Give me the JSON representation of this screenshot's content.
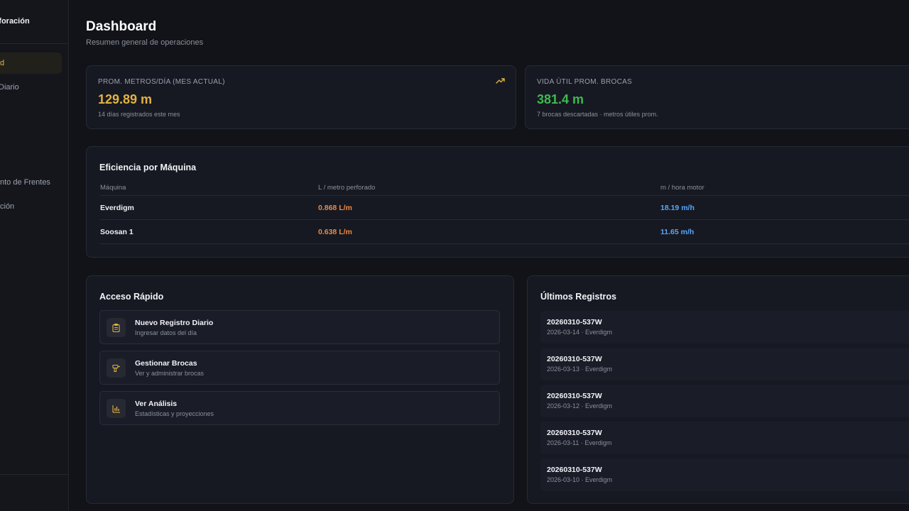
{
  "sidebar": {
    "brand": "rforación",
    "items": [
      {
        "label": "d",
        "active": true
      },
      {
        "label": "Diario"
      },
      {
        "label": ""
      },
      {
        "label": "nto de Frentes"
      },
      {
        "label": "ción"
      }
    ]
  },
  "header": {
    "title": "Dashboard",
    "subtitle": "Resumen general de operaciones"
  },
  "stats": [
    {
      "label": "PROM. METROS/DÍA (MES ACTUAL)",
      "value": "129.89 m",
      "note": "14 días registrados este mes",
      "color": "#e3b341",
      "icon": "trend-up-icon"
    },
    {
      "label": "VIDA ÚTIL PROM. BROCAS",
      "value": "381.4 m",
      "note": "7 brocas descartadas · metros útiles prom.",
      "color": "#3fb950"
    }
  ],
  "efficiency": {
    "title": "Eficiencia por Máquina",
    "columns": [
      "Máquina",
      "L / metro perforado",
      "m / hora motor"
    ],
    "rows": [
      {
        "machine": "Everdigm",
        "l_per_meter": "0.868 L/m",
        "m_per_hour": "18.19 m/h"
      },
      {
        "machine": "Soosan 1",
        "l_per_meter": "0.638 L/m",
        "m_per_hour": "11.65 m/h"
      }
    ]
  },
  "quick_access": {
    "title": "Acceso Rápido",
    "items": [
      {
        "title": "Nuevo Registro Diario",
        "subtitle": "Ingresar datos del día",
        "icon": "clipboard-icon"
      },
      {
        "title": "Gestionar Brocas",
        "subtitle": "Ver y administrar brocas",
        "icon": "drill-icon"
      },
      {
        "title": "Ver Análisis",
        "subtitle": "Estadísticas y proyecciones",
        "icon": "bar-chart-icon"
      }
    ]
  },
  "recent": {
    "title": "Últimos Registros",
    "items": [
      {
        "code": "20260310-537W",
        "meta": "2026-03-14 · Everdigm"
      },
      {
        "code": "20260310-537W",
        "meta": "2026-03-13 · Everdigm"
      },
      {
        "code": "20260310-537W",
        "meta": "2026-03-12 · Everdigm"
      },
      {
        "code": "20260310-537W",
        "meta": "2026-03-11 · Everdigm"
      },
      {
        "code": "20260310-537W",
        "meta": "2026-03-10 · Everdigm"
      }
    ]
  }
}
